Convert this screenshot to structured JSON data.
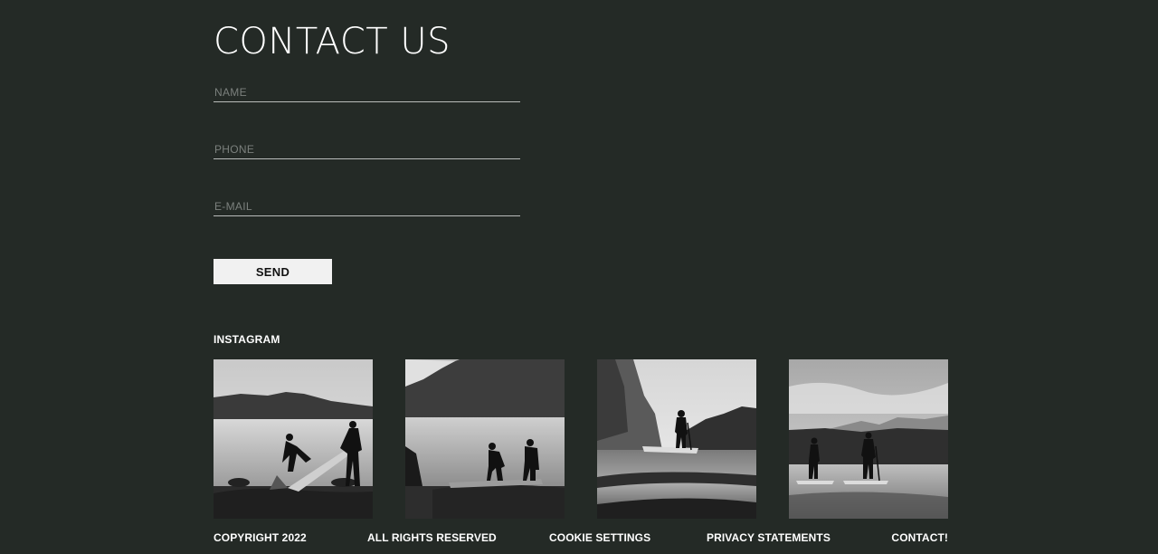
{
  "contact": {
    "title": "CONTACT US",
    "name_placeholder": "NAME",
    "phone_placeholder": "PHONE",
    "email_placeholder": "E-MAIL",
    "send_label": "SEND"
  },
  "instagram": {
    "heading": "INSTAGRAM",
    "photos": [
      "two people unpacking paddle board on lakeshore",
      "two people preparing boards by mountain lake",
      "person standing on paddle board near forest",
      "two people paddle boarding below mountains"
    ]
  },
  "footer": {
    "copyright": "COPYRIGHT 2022",
    "rights": "ALL RIGHTS RESERVED",
    "cookies": "COOKIE SETTINGS",
    "privacy": "PRIVACY STATEMENTS",
    "contact": "CONTACT!"
  },
  "colors": {
    "background": "#242a26",
    "button_bg": "#f1f1f1",
    "text": "#ffffff"
  }
}
